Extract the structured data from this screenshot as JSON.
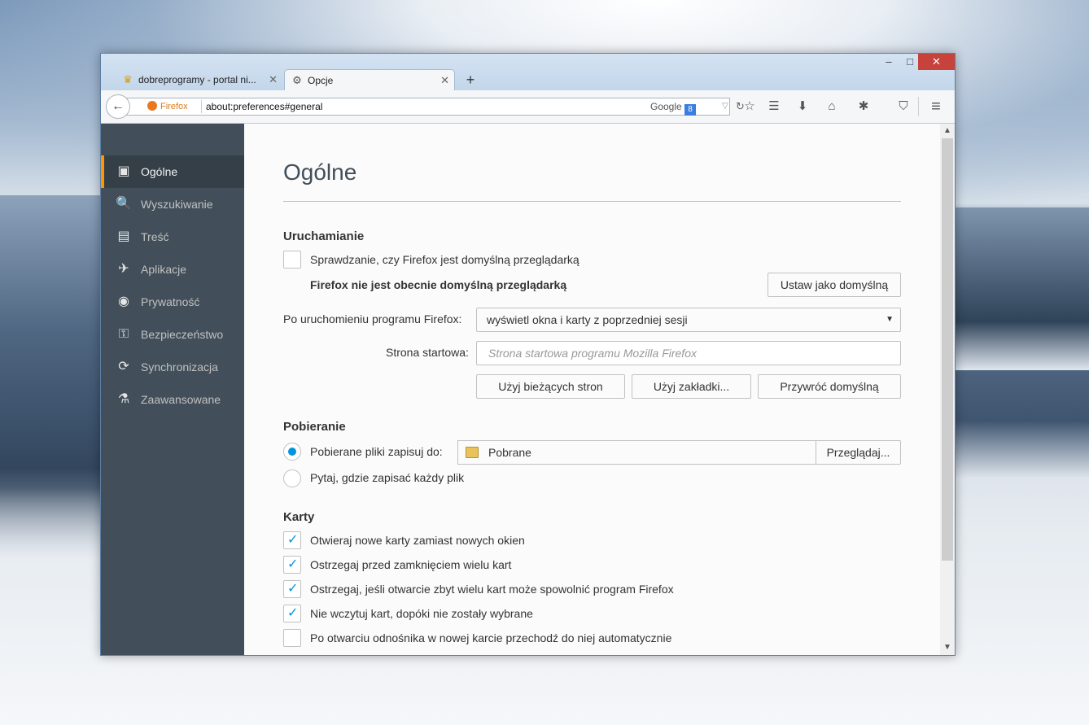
{
  "window": {
    "controls": {
      "minimize": "–",
      "maximize": "□",
      "close": "✕"
    },
    "tabs": [
      {
        "label": "dobreprogramy - portal ni...",
        "icon": "dobreprogramy-favicon",
        "icon_glyph": "♛",
        "close": "✕"
      },
      {
        "label": "Opcje",
        "icon": "gear-icon",
        "icon_glyph": "⚙",
        "close": "✕"
      }
    ],
    "new_tab": "+"
  },
  "navbar": {
    "back_glyph": "←",
    "identity_label": "Firefox",
    "url": "about:preferences#general",
    "search_engine": "Google",
    "search_badge": "8",
    "dropdown_glyph": "▽",
    "reload_glyph": "↻",
    "toolbar_icons": [
      {
        "name": "bookmark-star-icon",
        "glyph": "☆"
      },
      {
        "name": "bookmarks-menu-icon",
        "glyph": "☰"
      },
      {
        "name": "downloads-icon",
        "glyph": "⬇"
      },
      {
        "name": "home-icon",
        "glyph": "⌂"
      },
      {
        "name": "extension-icon",
        "glyph": "✱"
      },
      {
        "name": "ublock-icon",
        "glyph": "⛉"
      },
      {
        "name": "menu-icon",
        "glyph": "≡"
      }
    ]
  },
  "sidebar": {
    "items": [
      {
        "label": "Ogólne",
        "icon_glyph": "▣",
        "active": true
      },
      {
        "label": "Wyszukiwanie",
        "icon_glyph": "🔍"
      },
      {
        "label": "Treść",
        "icon_glyph": "▤"
      },
      {
        "label": "Aplikacje",
        "icon_glyph": "✈"
      },
      {
        "label": "Prywatność",
        "icon_glyph": "◉"
      },
      {
        "label": "Bezpieczeństwo",
        "icon_glyph": "⚿"
      },
      {
        "label": "Synchronizacja",
        "icon_glyph": "⟳"
      },
      {
        "label": "Zaawansowane",
        "icon_glyph": "⚗"
      }
    ]
  },
  "main": {
    "title": "Ogólne",
    "startup": {
      "heading": "Uruchamianie",
      "check_default_label": "Sprawdzanie, czy Firefox jest domyślną przeglądarką",
      "check_default_checked": false,
      "not_default_text": "Firefox nie jest obecnie domyślną przeglądarką",
      "set_default_button": "Ustaw jako domyślną",
      "when_starts_label": "Po uruchomieniu programu Firefox:",
      "when_starts_value": "wyświetl okna i karty z poprzedniej sesji",
      "homepage_label": "Strona startowa:",
      "homepage_placeholder": "Strona startowa programu Mozilla Firefox",
      "use_current_button": "Użyj bieżących stron",
      "use_bookmark_button": "Użyj zakładki...",
      "restore_default_button": "Przywróć domyślną"
    },
    "downloads": {
      "heading": "Pobieranie",
      "save_to_label": "Pobierane pliki zapisuj do:",
      "save_to_selected": true,
      "folder_name": "Pobrane",
      "browse_button": "Przeglądaj...",
      "always_ask_label": "Pytaj, gdzie zapisać każdy plik",
      "always_ask_selected": false
    },
    "tabs": {
      "heading": "Karty",
      "options": [
        {
          "label": "Otwieraj nowe karty zamiast nowych okien",
          "checked": true
        },
        {
          "label": "Ostrzegaj przed zamknięciem wielu kart",
          "checked": true
        },
        {
          "label": "Ostrzegaj, jeśli otwarcie zbyt wielu kart może spowolnić program Firefox",
          "checked": true
        },
        {
          "label": "Nie wczytuj kart, dopóki nie zostały wybrane",
          "checked": true
        },
        {
          "label": "Po otwarciu odnośnika w nowej karcie przechodź do niej automatycznie",
          "checked": false
        }
      ]
    }
  },
  "colors": {
    "accent": "#0095dd",
    "sidebar_bg": "#424f5a",
    "sidebar_active_border": "#ff9500",
    "close_button": "#c7423b"
  }
}
